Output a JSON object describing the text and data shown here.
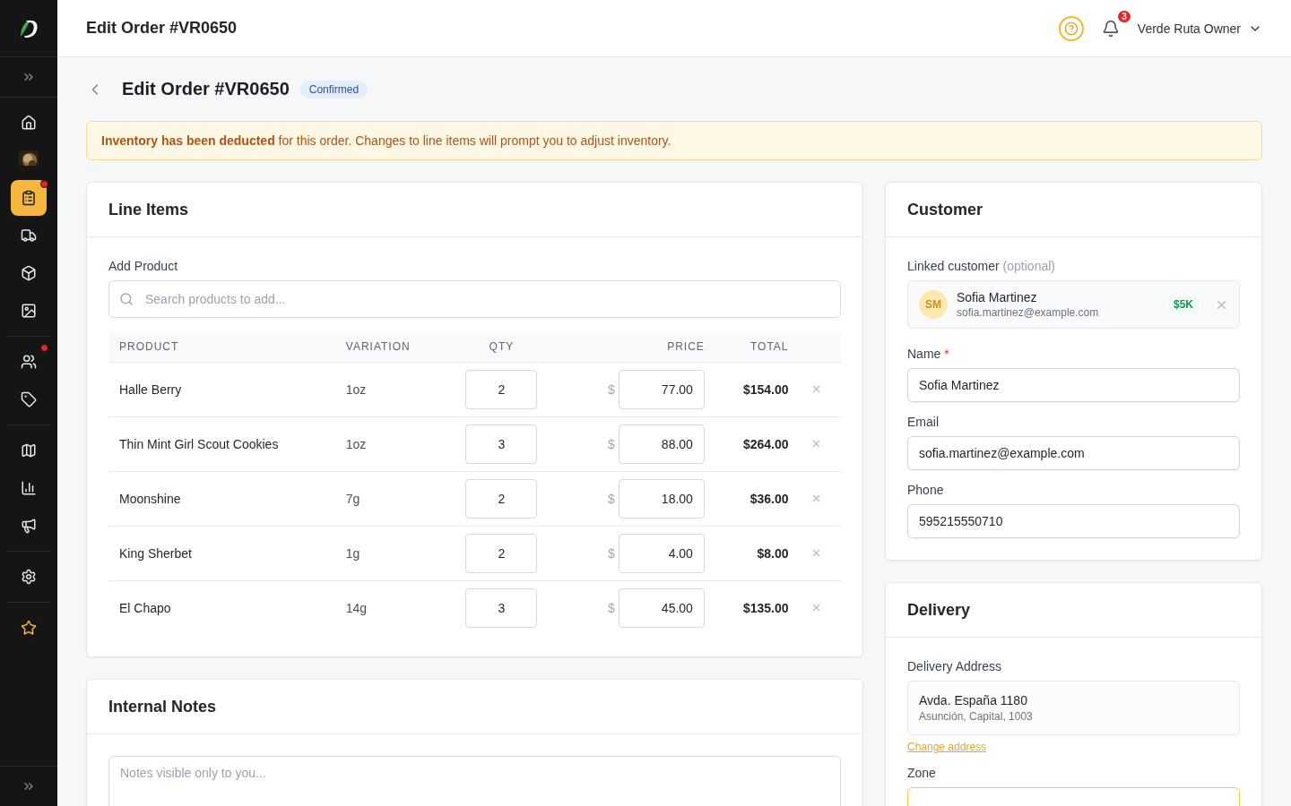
{
  "sidebar": {
    "groups": [
      [
        {
          "kind": "nav",
          "selected": false,
          "dot": false
        },
        {
          "kind": "picture",
          "selected": false,
          "dot": false
        },
        {
          "kind": "nav",
          "selected": true,
          "dot": true
        },
        {
          "kind": "nav",
          "selected": false,
          "dot": false
        },
        {
          "kind": "nav",
          "selected": false,
          "dot": false
        },
        {
          "kind": "nav",
          "selected": false,
          "dot": false
        }
      ],
      [
        {
          "kind": "nav",
          "selected": false,
          "dot": true
        },
        {
          "kind": "nav",
          "selected": false,
          "dot": false
        }
      ],
      [
        {
          "kind": "nav",
          "selected": false,
          "dot": false
        },
        {
          "kind": "nav",
          "selected": false,
          "dot": false
        },
        {
          "kind": "nav",
          "selected": false,
          "dot": false
        }
      ],
      [
        {
          "kind": "nav",
          "selected": false,
          "dot": false
        }
      ],
      [
        {
          "kind": "favorite",
          "selected": false,
          "dot": false
        }
      ]
    ]
  },
  "header": {
    "title": "Edit Order #VR0650",
    "notifications": "3",
    "user": "Verde Ruta Owner"
  },
  "page": {
    "title": "Edit Order #VR0650",
    "status": "Confirmed"
  },
  "alert": "**Inventory has been deducted** for this order. Changes to line items will prompt you to adjust inventory.",
  "line_items": {
    "title": "Line Items",
    "add_label": "Add Product",
    "search_placeholder": "Search products to add...",
    "columns": [
      "PRODUCT",
      "VARIATION",
      "QTY",
      "PRICE",
      "TOTAL"
    ],
    "rows": [
      {
        "product": "Halle Berry",
        "variation": "1oz",
        "qty": "2",
        "currency": "$",
        "price": "77.00",
        "total": "$154.00"
      },
      {
        "product": "Thin Mint Girl Scout Cookies",
        "variation": "1oz",
        "qty": "3",
        "currency": "$",
        "price": "88.00",
        "total": "$264.00"
      },
      {
        "product": "Moonshine",
        "variation": "7g",
        "qty": "2",
        "currency": "$",
        "price": "18.00",
        "total": "$36.00"
      },
      {
        "product": "King Sherbet",
        "variation": "1g",
        "qty": "2",
        "currency": "$",
        "price": "4.00",
        "total": "$8.00"
      },
      {
        "product": "El Chapo",
        "variation": "14g",
        "qty": "3",
        "currency": "$",
        "price": "45.00",
        "total": "$135.00"
      }
    ]
  },
  "notes": {
    "title": "Internal Notes",
    "placeholder": "Notes visible only to you..."
  },
  "customer": {
    "title": "Customer",
    "linked_label": "Linked customer",
    "linked_hint": "(optional)",
    "linked": {
      "initials": "SM",
      "name": "Sofia Martinez",
      "email": "sofia.martinez@example.com",
      "value": "$5K"
    },
    "fields": [
      {
        "label": "Name",
        "required_mark": "*",
        "value": "Sofia Martinez"
      },
      {
        "label": "Email",
        "value": "sofia.martinez@example.com"
      },
      {
        "label": "Phone",
        "value": "595215550710"
      }
    ]
  },
  "delivery": {
    "title": "Delivery",
    "address_label": "Delivery Address",
    "address_line1": "Avda. España 1180",
    "address_line2": "Asunción, Capital, 1003",
    "change_link": "Change address",
    "zone_label": "Zone"
  }
}
